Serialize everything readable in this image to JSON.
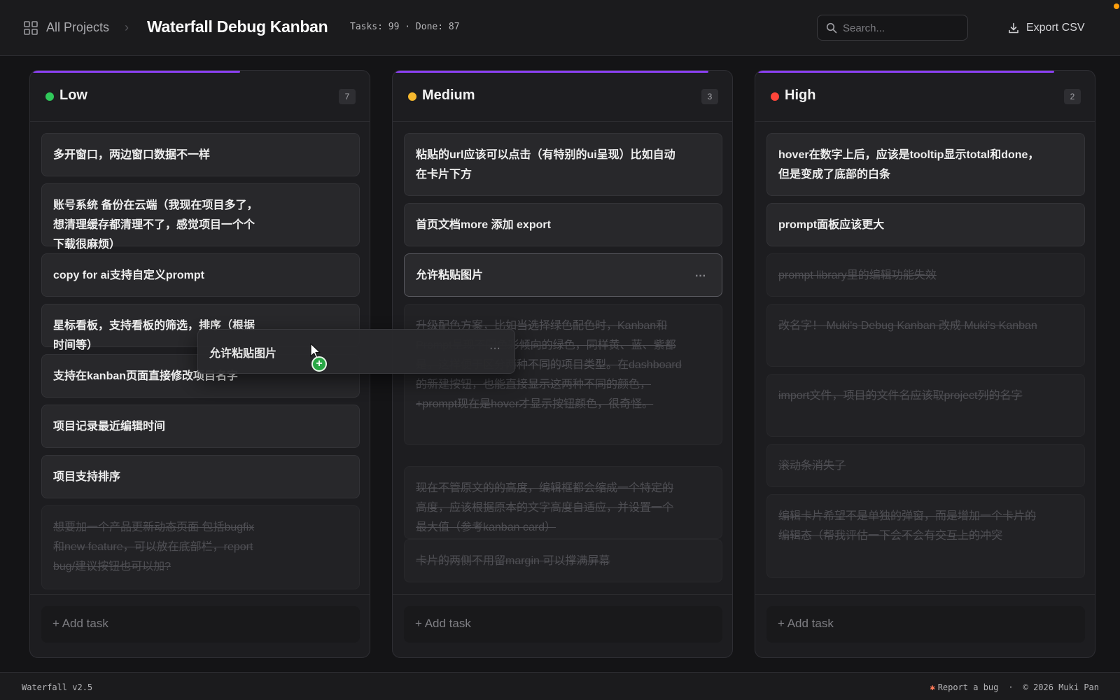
{
  "header": {
    "breadcrumb_root": "All Projects",
    "breadcrumb_sep": "›",
    "title": "Waterfall Debug Kanban",
    "stats": "Tasks: 99 · Done: 87",
    "search_placeholder": "Search...",
    "export_label": "Export CSV"
  },
  "columns": [
    {
      "title": "Low",
      "count": "7",
      "dot_color": "#30c85a",
      "progress_pct": 63,
      "cards": [
        {
          "text": "多开窗口，两边窗口数据不一样",
          "done": false
        },
        {
          "text": "账号系统 备份在云端（我现在项目多了，想清理缓存都清理不了，感觉项目一个个下载很麻烦）",
          "done": false
        },
        {
          "text": "copy for ai支持自定义prompt",
          "done": false
        },
        {
          "text": "星标看板，支持看板的筛选，排序（根据时间等）",
          "done": false
        },
        {
          "text": "支持在kanban页面直接修改项目名字",
          "done": false
        },
        {
          "text": "项目记录最近编辑时间",
          "done": false
        },
        {
          "text": "项目支持排序",
          "done": false
        },
        {
          "text": "想要加一个产品更新动态页面 包括bugfix和new feature，可以放在底部栏，report bug/建议按钮也可以加?",
          "done": true
        }
      ],
      "add_label": "+ Add task"
    },
    {
      "title": "Medium",
      "count": "3",
      "dot_color": "#f5b82e",
      "progress_pct": 95,
      "cards": [
        {
          "text": "粘贴的url应该可以点击（有特别的ui呈现）比如自动在卡片下方",
          "done": false
        },
        {
          "text": "首页文档more 添加 export",
          "done": false
        },
        {
          "text": "允许粘贴图片",
          "done": false,
          "active": true
        },
        {
          "text": "升级配色方案，比如当选择绿色配色时，Kanban和Prompt呈现不同色彩倾向的绿色，同样黄、蓝、紫都是。这样便于区分两种不同的项目类型。在dashboard的新建按钮，也能直接显示这两种不同的颜色，+prompt现在是hover才显示按钮颜色，很奇怪。",
          "done": true
        },
        {
          "text": "现在不管原文的的高度，编辑框都会缩成一个特定的高度，应该根据原本的文字高度自适应，并设置一个最大值（参考kanban card）",
          "done": true
        },
        {
          "text": "卡片的两侧不用留margin 可以撑满屏幕",
          "done": true
        }
      ],
      "add_label": "+ Add task"
    },
    {
      "title": "High",
      "count": "2",
      "dot_color": "#ff453a",
      "progress_pct": 90,
      "cards": [
        {
          "text": "hover在数字上后，应该是tooltip显示total和done，但是变成了底部的白条",
          "done": false
        },
        {
          "text": "prompt面板应该更大",
          "done": false
        },
        {
          "text": "prompt library里的编辑功能失效",
          "done": true
        },
        {
          "text": "改名字！ Muki's Debug Kanban 改成 Muki's Kanban",
          "done": true
        },
        {
          "text": "import文件，项目的文件名应该取project列的名字",
          "done": true
        },
        {
          "text": "滚动条消失了",
          "done": true
        },
        {
          "text": "编辑卡片希望不是单独的弹窗，而是增加一个卡片的编辑态（帮我评估一下会不会有交互上的冲突",
          "done": true
        }
      ],
      "add_label": "+ Add task"
    }
  ],
  "card_more": "···",
  "drag_ghost": {
    "text": "允许粘贴图片",
    "more": "···",
    "badge": "+"
  },
  "footer": {
    "version": "Waterfall v2.5",
    "report": "Report a bug",
    "sep": "·",
    "copyright": "© 2026 Muki Pan"
  }
}
